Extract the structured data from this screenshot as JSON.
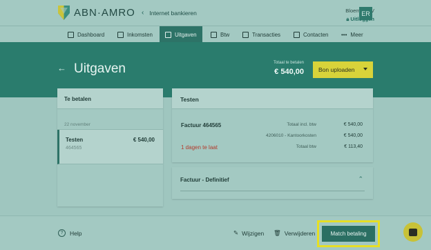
{
  "header": {
    "logo_text": "ABN·AMRO",
    "back_link": "Internet bankieren",
    "company": "Bloemen BV",
    "logout": "Uitloggen",
    "avatar_initials": "ER"
  },
  "nav": {
    "items": [
      {
        "label": "Dashboard",
        "icon": "dashboard-icon"
      },
      {
        "label": "Inkomsten",
        "icon": "document-icon"
      },
      {
        "label": "Uitgaven",
        "icon": "wallet-icon",
        "active": true
      },
      {
        "label": "Btw",
        "icon": "tax-icon"
      },
      {
        "label": "Transacties",
        "icon": "transactions-icon"
      },
      {
        "label": "Contacten",
        "icon": "contacts-icon"
      },
      {
        "label": "Meer",
        "icon": "more-icon"
      }
    ]
  },
  "hero": {
    "title": "Uitgaven",
    "due_label": "Totaal te betalen",
    "due_amount": "€ 540,00",
    "upload_label": "Bon uploaden"
  },
  "left": {
    "heading": "Te betalen",
    "date": "22 november",
    "item_name": "Testen",
    "item_number": "464565",
    "item_amount": "€ 540,00"
  },
  "detail": {
    "heading": "Testen",
    "invoice_title": "Factuur 464565",
    "rows": [
      {
        "label": "Totaal incl. btw",
        "value": "€ 540,00"
      },
      {
        "label": "4206010 - Kantoorkosten",
        "value": "€ 540,00"
      },
      {
        "label": "Totaal btw",
        "value": "€ 113,40"
      }
    ],
    "late_text": "1 dagen te laat",
    "definitive_title": "Factuur - Definitief"
  },
  "footer": {
    "help": "Help",
    "edit": "Wijzigen",
    "delete": "Verwijderen",
    "match": "Match betaling"
  },
  "colors": {
    "brand_green": "#2a7c6d",
    "accent_yellow": "#d8d33a",
    "late_red": "#b33a2b"
  }
}
